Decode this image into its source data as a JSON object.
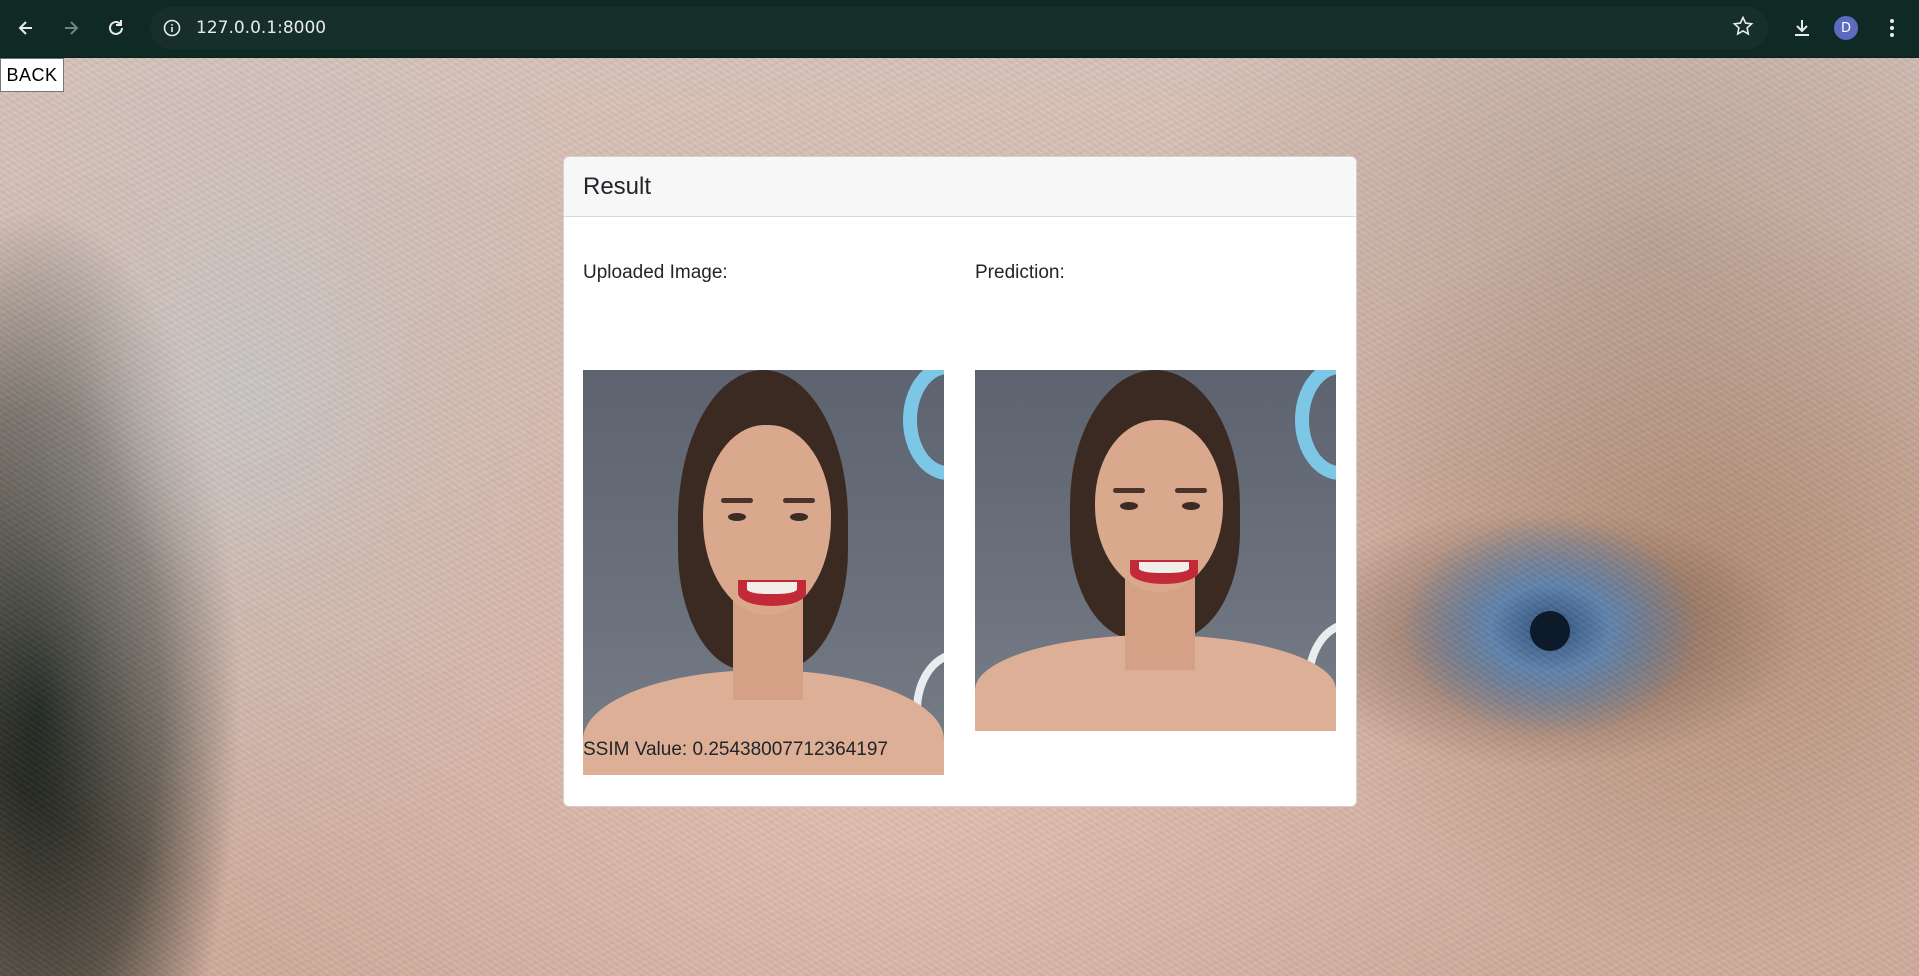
{
  "browser": {
    "url": "127.0.0.1:8000",
    "profile_initial": "D"
  },
  "page": {
    "back_label": "BACK"
  },
  "card": {
    "title": "Result",
    "uploaded_label": "Uploaded Image:",
    "prediction_label": "Prediction:",
    "ssim_text": "SSIM Value: 0.25438007712364197"
  }
}
